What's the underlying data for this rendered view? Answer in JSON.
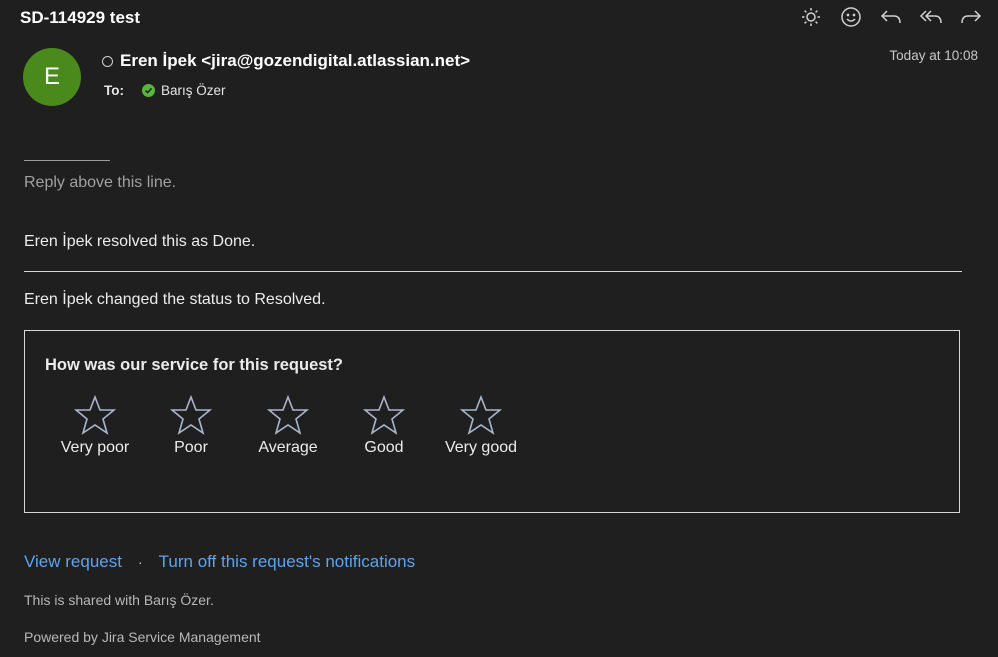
{
  "header": {
    "subject": "SD-114929 test"
  },
  "toolbar": {
    "icons": [
      "brightness-icon",
      "emoji-icon",
      "reply-icon",
      "reply-all-icon",
      "forward-icon"
    ]
  },
  "message": {
    "avatar_initial": "E",
    "avatar_color": "#4a8a1c",
    "from": "Eren İpek <jira@gozendigital.atlassian.net>",
    "to_label": "To:",
    "to_name": "Barış Özer",
    "date": "Today at 10:08"
  },
  "body": {
    "separator": "________",
    "reply_above": "Reply above this line.",
    "resolved_line": "Eren İpek resolved this as Done.",
    "status_line": "Eren İpek changed the status to Resolved."
  },
  "survey": {
    "question": "How was our service for this request?",
    "ratings": [
      "Very poor",
      "Poor",
      "Average",
      "Good",
      "Very good"
    ]
  },
  "links": {
    "view_request": "View request",
    "separator": "·",
    "turn_off": "Turn off this request's notifications"
  },
  "footer": {
    "shared": "This is shared with Barış Özer.",
    "powered": "Powered by Jira Service Management"
  },
  "colors": {
    "background": "#1f1f1f",
    "link": "#5aa5f0",
    "check": "#58b63e"
  }
}
